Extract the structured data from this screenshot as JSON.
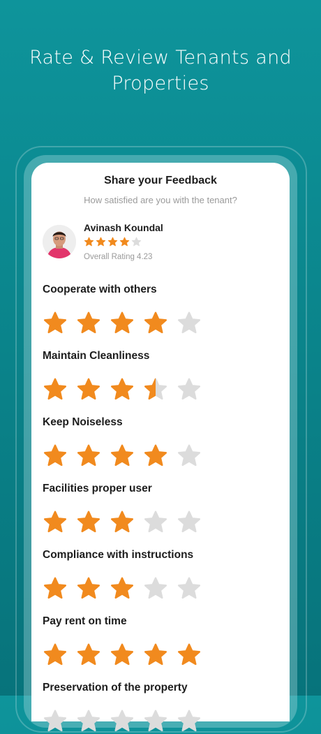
{
  "hero": {
    "line1": "Rate & Review Tenants and",
    "line2": "Properties"
  },
  "card": {
    "title": "Share your Feedback",
    "subtitle": "How satisfied are you with the tenant?"
  },
  "tenant": {
    "name": "Avinash Koundal",
    "stars": 4,
    "overall_text": "Overall Rating 4.23"
  },
  "categories": [
    {
      "label": "Cooperate with others",
      "rating": 4
    },
    {
      "label": "Maintain Cleanliness",
      "rating": 3.5
    },
    {
      "label": "Keep Noiseless",
      "rating": 4
    },
    {
      "label": "Facilities proper user",
      "rating": 3
    },
    {
      "label": "Compliance with instructions",
      "rating": 3
    },
    {
      "label": "Pay rent on time",
      "rating": 5
    },
    {
      "label": "Preservation of the property",
      "rating": 0
    }
  ],
  "colors": {
    "star_filled": "#f18a1e",
    "star_empty": "#dcdcdc",
    "background": "#0a8a91"
  },
  "icons": {
    "star": "star-icon",
    "avatar": "user-avatar"
  }
}
